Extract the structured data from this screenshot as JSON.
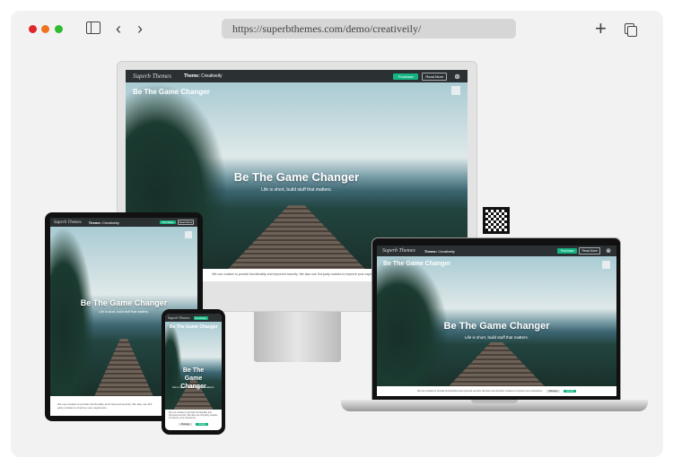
{
  "browser": {
    "url": "https://superbthemes.com/demo/creativeily/",
    "dots": [
      "#e0262b",
      "#f0731f",
      "#2fba2f"
    ]
  },
  "site": {
    "logo": "Superb Themes",
    "theme_label": "Theme:",
    "theme_name": "Creativeily",
    "purchase": "Purchase",
    "read_more": "Read More",
    "site_title": "Be The Game Changer",
    "hero_title": "Be The Game Changer",
    "hero_subtitle": "Life is short, build stuff that matters.",
    "cookie_text": "We use cookies to provide functionality and improved security. We also use 3rd-party cookies to improve your experience.",
    "manage": "Manage",
    "accept": "Accept",
    "accent": "#15b583"
  }
}
